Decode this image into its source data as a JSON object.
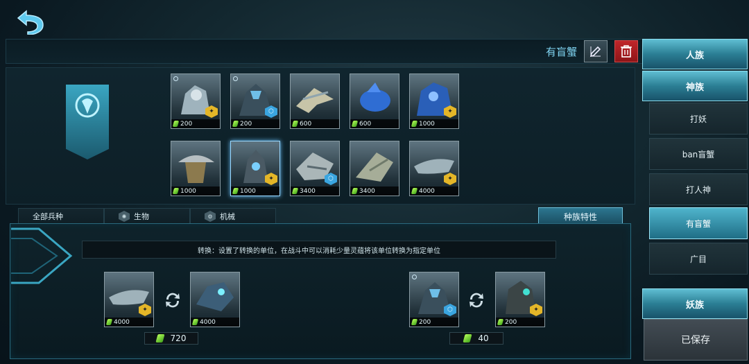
{
  "deck": {
    "name": "有盲蟹"
  },
  "units_grid": [
    {
      "cost": "200",
      "badge": "gold",
      "selected": false
    },
    {
      "cost": "200",
      "badge": "blue",
      "selected": false
    },
    {
      "cost": "600",
      "badge": "none",
      "selected": false
    },
    {
      "cost": "600",
      "badge": "none",
      "selected": false
    },
    {
      "cost": "1000",
      "badge": "gold",
      "selected": false
    },
    {
      "cost": "1000",
      "badge": "none",
      "selected": false
    },
    {
      "cost": "1000",
      "badge": "gold",
      "selected": true
    },
    {
      "cost": "3400",
      "badge": "blue",
      "selected": false
    },
    {
      "cost": "3400",
      "badge": "none",
      "selected": false
    },
    {
      "cost": "4000",
      "badge": "gold",
      "selected": false
    }
  ],
  "filter_tabs": [
    {
      "label": "全部兵种",
      "icon": ""
    },
    {
      "label": "生物",
      "icon": "bio-icon"
    },
    {
      "label": "机械",
      "icon": "mech-icon"
    }
  ],
  "trait_tab_label": "种族特性",
  "description": "转换：设置了转换的单位，在战斗中可以消耗少量灵蕴将该单位转换为指定单位",
  "conversions": [
    {
      "from_cost": "4000",
      "to_cost": "4000",
      "total": "720"
    },
    {
      "from_cost": "200",
      "to_cost": "200",
      "total": "40"
    }
  ],
  "factions": {
    "human": "人族",
    "protoss": "神族",
    "demon": "妖族"
  },
  "deck_list": [
    "打妖",
    "ban盲蟹",
    "打人神",
    "有盲蟹",
    "广目"
  ],
  "saved_label": "已保存",
  "colors": {
    "accent": "#4fb4cc",
    "delete": "#c0262a",
    "crystal": "#7ee03a",
    "gold_badge": "#e4b628",
    "blue_badge": "#3aa5e0"
  }
}
